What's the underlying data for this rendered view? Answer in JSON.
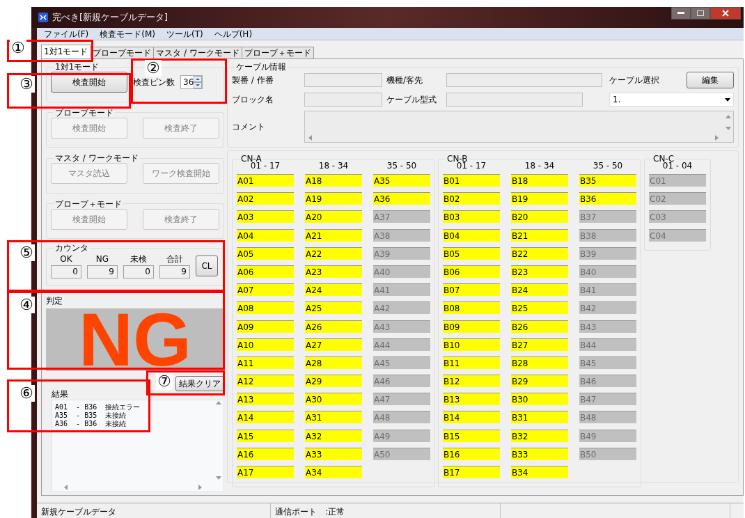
{
  "window": {
    "title": "完べき[新規ケーブルデータ]"
  },
  "menu": [
    {
      "label": "ファイル(F)"
    },
    {
      "label": "検査モード(M)"
    },
    {
      "label": "ツール(T)"
    },
    {
      "label": "ヘルプ(H)"
    }
  ],
  "tabs": [
    {
      "label": "1対1モード",
      "selected": true
    },
    {
      "label": "プローブモード",
      "selected": false
    },
    {
      "label": "マスタ / ワークモード",
      "selected": false
    },
    {
      "label": "プローブ＋モード",
      "selected": false
    }
  ],
  "one_to_one": {
    "title": "1対1モード",
    "start_button": "検査開始",
    "pin_count_label": "検査ピン数",
    "pin_count": "36"
  },
  "mode_groups": [
    {
      "title": "プローブモード",
      "buttons": [
        {
          "label": "検査開始",
          "disabled": true
        },
        {
          "label": "検査終了",
          "disabled": true
        }
      ]
    },
    {
      "title": "マスタ / ワークモード",
      "buttons": [
        {
          "label": "マスタ読込",
          "disabled": true
        },
        {
          "label": "ワーク検査開始",
          "disabled": true
        }
      ]
    },
    {
      "title": "プローブ＋モード",
      "buttons": [
        {
          "label": "検査開始",
          "disabled": true
        },
        {
          "label": "検査終了",
          "disabled": true
        }
      ]
    }
  ],
  "counter": {
    "title": "カウンタ",
    "items": [
      {
        "label": "OK",
        "value": "0"
      },
      {
        "label": "NG",
        "value": "9"
      },
      {
        "label": "未検",
        "value": "0"
      },
      {
        "label": "合計",
        "value": "9"
      }
    ],
    "clear_button": "CL"
  },
  "judgement": {
    "title": "判定",
    "result": "NG"
  },
  "clear_results_button": "結果クリア",
  "results": {
    "title": "結果",
    "lines": [
      "A01  - B36  接続エラー",
      "A35  - B35  未接続",
      "A36  - B36  未接続"
    ]
  },
  "cable_info": {
    "title": "ケーブル情報",
    "fields": [
      {
        "label": "製番 / 作番"
      },
      {
        "label": "機種/客先"
      },
      {
        "label": "ブロック名"
      },
      {
        "label": "ケーブル型式"
      }
    ],
    "comment_label": "コメント",
    "cable_select_label": "ケーブル選択",
    "cable_select_value": "1.",
    "edit_button": "編集"
  },
  "connectors": [
    {
      "name": "CN-A",
      "columns": [
        {
          "range": "01 - 17",
          "pins": [
            {
              "label": "A01",
              "active": true
            },
            {
              "label": "A02",
              "active": true
            },
            {
              "label": "A03",
              "active": true
            },
            {
              "label": "A04",
              "active": true
            },
            {
              "label": "A05",
              "active": true
            },
            {
              "label": "A06",
              "active": true
            },
            {
              "label": "A07",
              "active": true
            },
            {
              "label": "A08",
              "active": true
            },
            {
              "label": "A09",
              "active": true
            },
            {
              "label": "A10",
              "active": true
            },
            {
              "label": "A11",
              "active": true
            },
            {
              "label": "A12",
              "active": true
            },
            {
              "label": "A13",
              "active": true
            },
            {
              "label": "A14",
              "active": true
            },
            {
              "label": "A15",
              "active": true
            },
            {
              "label": "A16",
              "active": true
            },
            {
              "label": "A17",
              "active": true
            }
          ]
        },
        {
          "range": "18 - 34",
          "pins": [
            {
              "label": "A18",
              "active": true
            },
            {
              "label": "A19",
              "active": true
            },
            {
              "label": "A20",
              "active": true
            },
            {
              "label": "A21",
              "active": true
            },
            {
              "label": "A22",
              "active": true
            },
            {
              "label": "A23",
              "active": true
            },
            {
              "label": "A24",
              "active": true
            },
            {
              "label": "A25",
              "active": true
            },
            {
              "label": "A26",
              "active": true
            },
            {
              "label": "A27",
              "active": true
            },
            {
              "label": "A28",
              "active": true
            },
            {
              "label": "A29",
              "active": true
            },
            {
              "label": "A30",
              "active": true
            },
            {
              "label": "A31",
              "active": true
            },
            {
              "label": "A32",
              "active": true
            },
            {
              "label": "A33",
              "active": true
            },
            {
              "label": "A34",
              "active": true
            }
          ]
        },
        {
          "range": "35 - 50",
          "pins": [
            {
              "label": "A35",
              "active": true
            },
            {
              "label": "A36",
              "active": true
            },
            {
              "label": "A37",
              "active": false
            },
            {
              "label": "A38",
              "active": false
            },
            {
              "label": "A39",
              "active": false
            },
            {
              "label": "A40",
              "active": false
            },
            {
              "label": "A41",
              "active": false
            },
            {
              "label": "A42",
              "active": false
            },
            {
              "label": "A43",
              "active": false
            },
            {
              "label": "A44",
              "active": false
            },
            {
              "label": "A45",
              "active": false
            },
            {
              "label": "A46",
              "active": false
            },
            {
              "label": "A47",
              "active": false
            },
            {
              "label": "A48",
              "active": false
            },
            {
              "label": "A49",
              "active": false
            },
            {
              "label": "A50",
              "active": false
            }
          ]
        }
      ]
    },
    {
      "name": "CN-B",
      "columns": [
        {
          "range": "01 - 17",
          "pins": [
            {
              "label": "B01",
              "active": true
            },
            {
              "label": "B02",
              "active": true
            },
            {
              "label": "B03",
              "active": true
            },
            {
              "label": "B04",
              "active": true
            },
            {
              "label": "B05",
              "active": true
            },
            {
              "label": "B06",
              "active": true
            },
            {
              "label": "B07",
              "active": true
            },
            {
              "label": "B08",
              "active": true
            },
            {
              "label": "B09",
              "active": true
            },
            {
              "label": "B10",
              "active": true
            },
            {
              "label": "B11",
              "active": true
            },
            {
              "label": "B12",
              "active": true
            },
            {
              "label": "B13",
              "active": true
            },
            {
              "label": "B14",
              "active": true
            },
            {
              "label": "B15",
              "active": true
            },
            {
              "label": "B16",
              "active": true
            },
            {
              "label": "B17",
              "active": true
            }
          ]
        },
        {
          "range": "18 - 34",
          "pins": [
            {
              "label": "B18",
              "active": true
            },
            {
              "label": "B19",
              "active": true
            },
            {
              "label": "B20",
              "active": true
            },
            {
              "label": "B21",
              "active": true
            },
            {
              "label": "B22",
              "active": true
            },
            {
              "label": "B23",
              "active": true
            },
            {
              "label": "B24",
              "active": true
            },
            {
              "label": "B25",
              "active": true
            },
            {
              "label": "B26",
              "active": true
            },
            {
              "label": "B27",
              "active": true
            },
            {
              "label": "B28",
              "active": true
            },
            {
              "label": "B29",
              "active": true
            },
            {
              "label": "B30",
              "active": true
            },
            {
              "label": "B31",
              "active": true
            },
            {
              "label": "B32",
              "active": true
            },
            {
              "label": "B33",
              "active": true
            },
            {
              "label": "B34",
              "active": true
            }
          ]
        },
        {
          "range": "35 - 50",
          "pins": [
            {
              "label": "B35",
              "active": true
            },
            {
              "label": "B36",
              "active": true
            },
            {
              "label": "B37",
              "active": false
            },
            {
              "label": "B38",
              "active": false
            },
            {
              "label": "B39",
              "active": false
            },
            {
              "label": "B40",
              "active": false
            },
            {
              "label": "B41",
              "active": false
            },
            {
              "label": "B42",
              "active": false
            },
            {
              "label": "B43",
              "active": false
            },
            {
              "label": "B44",
              "active": false
            },
            {
              "label": "B45",
              "active": false
            },
            {
              "label": "B46",
              "active": false
            },
            {
              "label": "B47",
              "active": false
            },
            {
              "label": "B48",
              "active": false
            },
            {
              "label": "B49",
              "active": false
            },
            {
              "label": "B50",
              "active": false
            }
          ]
        }
      ]
    },
    {
      "name": "CN-C",
      "columns": [
        {
          "range": "01 - 04",
          "pins": [
            {
              "label": "C01",
              "active": false
            },
            {
              "label": "C02",
              "active": false
            },
            {
              "label": "C03",
              "active": false
            },
            {
              "label": "C04",
              "active": false
            }
          ]
        }
      ]
    }
  ],
  "status_bar": [
    {
      "text": "新規ケーブルデータ"
    },
    {
      "text": "通信ポート　:正常"
    }
  ],
  "annotations": [
    {
      "label": "①"
    },
    {
      "label": "②"
    },
    {
      "label": "③"
    },
    {
      "label": "⑤"
    },
    {
      "label": "④"
    },
    {
      "label": "⑦"
    },
    {
      "label": "⑥"
    }
  ]
}
